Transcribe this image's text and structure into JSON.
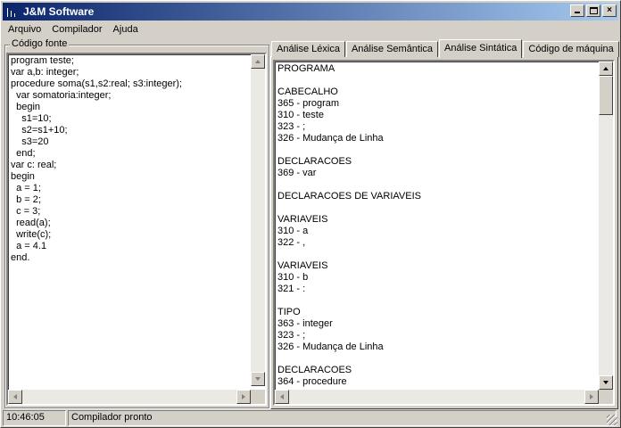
{
  "window": {
    "title": "J&M Software",
    "minimize_glyph": "",
    "close_glyph": "×"
  },
  "menu": [
    {
      "label": "Arquivo"
    },
    {
      "label": "Compilador"
    },
    {
      "label": "Ajuda"
    }
  ],
  "source_panel": {
    "label": "Código fonte",
    "lines": [
      "program teste;",
      "var a,b: integer;",
      "procedure soma(s1,s2:real; s3:integer);",
      "  var somatoria:integer;",
      "  begin",
      "    s1=10;",
      "    s2=s1+10;",
      "    s3=20",
      "  end;",
      "var c: real;",
      "begin",
      "  a = 1;",
      "  b = 2;",
      "  c = 3;",
      "  read(a);",
      "  write(c);",
      "  a = 4.1",
      "end."
    ]
  },
  "tabs": [
    {
      "label": "Análise Léxica",
      "active": false
    },
    {
      "label": "Análise Semântica",
      "active": false
    },
    {
      "label": "Análise Sintática",
      "active": true
    },
    {
      "label": "Código de máquina",
      "active": false
    }
  ],
  "output_lines": [
    "PROGRAMA",
    "",
    "CABECALHO",
    "365 - program",
    "310 - teste",
    "323 - ;",
    "326 - Mudança de Linha",
    "",
    "DECLARACOES",
    "369 - var",
    "",
    "DECLARACOES DE VARIAVEIS",
    "",
    "VARIAVEIS",
    "310 - a",
    "322 - ,",
    "",
    "VARIAVEIS",
    "310 - b",
    "321 - :",
    "",
    "TIPO",
    "363 - integer",
    "323 - ;",
    "326 - Mudança de Linha",
    "",
    "DECLARACOES",
    "364 - procedure"
  ],
  "status": {
    "time": "10:46:05",
    "message": "Compilador pronto"
  },
  "colors": {
    "titlebar_start": "#0a246a",
    "titlebar_end": "#a6caf0",
    "face": "#d4d0c8"
  }
}
